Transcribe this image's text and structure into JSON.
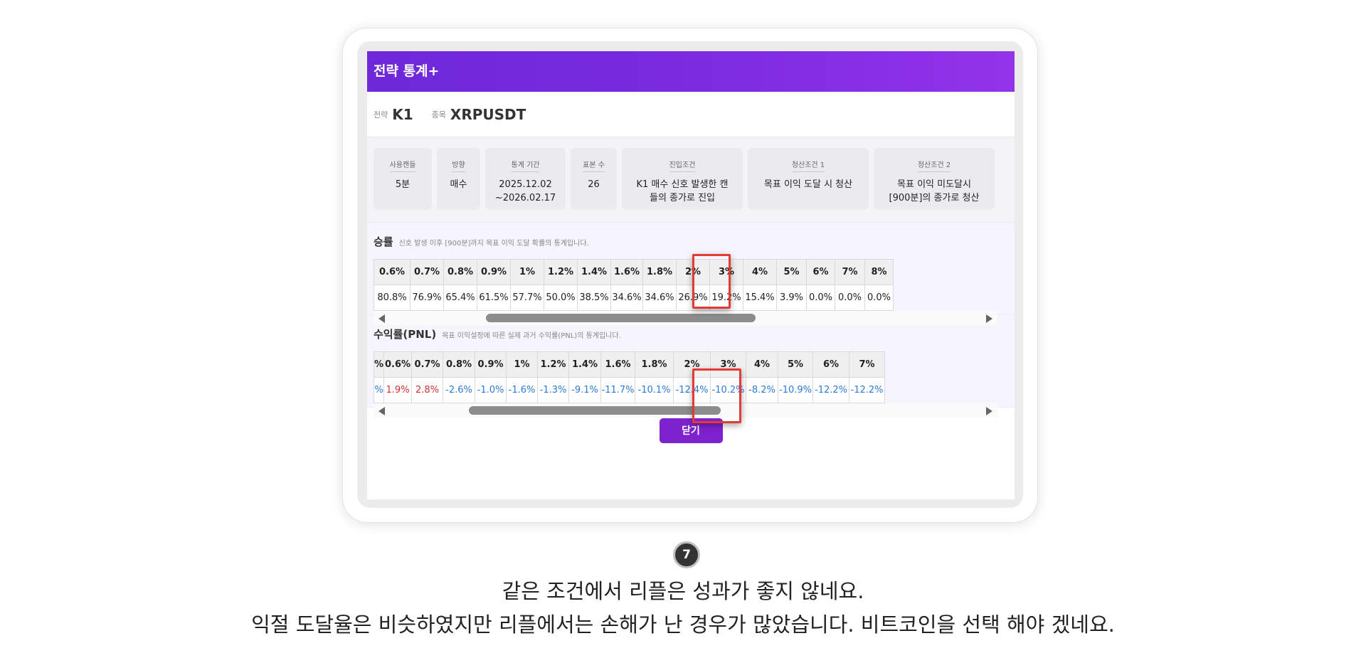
{
  "modal": {
    "title": "전략 통계+",
    "strategy_label": "전략",
    "strategy_value": "K1",
    "symbol_label": "종목",
    "symbol_value": "XRPUSDT",
    "close_label": "닫기"
  },
  "cards": [
    {
      "label": "사용캔들",
      "lines": [
        "5분"
      ]
    },
    {
      "label": "방향",
      "lines": [
        "매수"
      ]
    },
    {
      "label": "통계 기간",
      "lines": [
        "2025.12.02",
        "~2026.02.17"
      ]
    },
    {
      "label": "표본 수",
      "lines": [
        "26"
      ]
    },
    {
      "label": "진입조건",
      "lines": [
        "K1 매수 신호 발생한 캔",
        "들의 종가로 진입"
      ]
    },
    {
      "label": "청산조건 1",
      "lines": [
        "목표 이익 도달 시 청산"
      ]
    },
    {
      "label": "청산조건 2",
      "lines": [
        "목표 이익 미도달시",
        "[900분]의 종가로 청산"
      ]
    }
  ],
  "winrate": {
    "title": "승률",
    "subtitle": "신호 발생 이후 [900분]까지 목표 이익 도달 확률의 통계입니다.",
    "headers": [
      "0.6%",
      "0.7%",
      "0.8%",
      "0.9%",
      "1%",
      "1.2%",
      "1.4%",
      "1.6%",
      "1.8%",
      "2%",
      "3%",
      "4%",
      "5%",
      "6%",
      "7%",
      "8%"
    ],
    "values": [
      "80.8%",
      "76.9%",
      "65.4%",
      "61.5%",
      "57.7%",
      "50.0%",
      "38.5%",
      "34.6%",
      "34.6%",
      "26.9%",
      "19.2%",
      "15.4%",
      "3.9%",
      "0.0%",
      "0.0%",
      "0.0%"
    ],
    "highlight": "1.8%"
  },
  "pnl": {
    "title": "수익률(PNL)",
    "subtitle": "목표 이익설정에 따른 실제 과거 수익률(PNL)의 통계입니다.",
    "headers": [
      "%",
      "0.6%",
      "0.7%",
      "0.8%",
      "0.9%",
      "1%",
      "1.2%",
      "1.4%",
      "1.6%",
      "1.8%",
      "2%",
      "3%",
      "4%",
      "5%",
      "6%",
      "7%"
    ],
    "values": [
      "%",
      "1.9%",
      "2.8%",
      "-2.6%",
      "-1.0%",
      "-1.6%",
      "-1.3%",
      "-9.1%",
      "-11.7%",
      "-10.1%",
      "-12.4%",
      "-10.2%",
      "-8.2%",
      "-10.9%",
      "-12.2%",
      "-12.2%"
    ],
    "highlight": "1.8%"
  },
  "step_number": "7",
  "caption_lines": [
    "같은 조건에서 리플은 성과가 좋지 않네요.",
    "익절 도달율은 비슷하였지만 리플에서는 손해가 난 경우가 많았습니다. 비트코인을 선택 해야 겠네요."
  ],
  "colors": {
    "header_gradient_start": "#6d28d9",
    "header_gradient_end": "#9333ea",
    "positive": "#d63031",
    "negative": "#2d7bd6",
    "highlight": "#e53935",
    "button": "#7e22ce"
  }
}
